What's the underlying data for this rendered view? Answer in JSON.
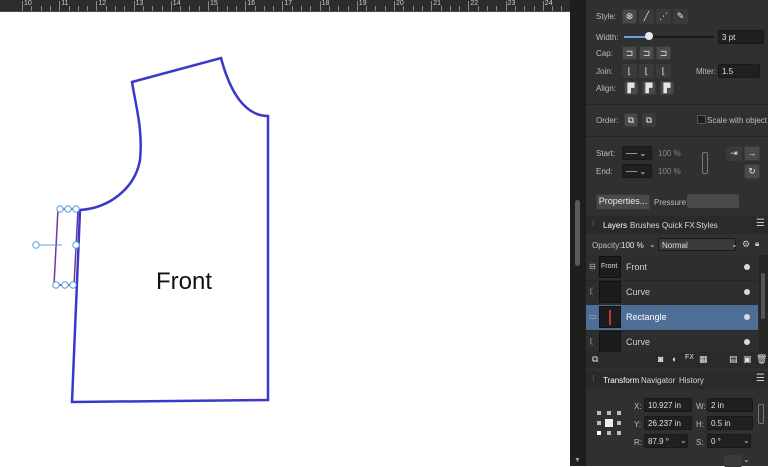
{
  "ruler": {
    "numbers": [
      "10",
      "11",
      "12",
      "13",
      "14",
      "15",
      "16",
      "17",
      "18",
      "19",
      "20",
      "21",
      "22",
      "23",
      "24"
    ]
  },
  "canvas": {
    "shape_label": "Front"
  },
  "stroke": {
    "style_label": "Style:",
    "width_label": "Width:",
    "width_value": "3 pt",
    "width_fraction": 0.28,
    "cap_label": "Cap:",
    "join_label": "Join:",
    "miter_label": "Miter:",
    "miter_value": "1.5",
    "align_label": "Align:",
    "order_label": "Order:",
    "scale_label": "Scale with object",
    "start_label": "Start:",
    "end_label": "End:",
    "start_pct": "100 %",
    "end_pct": "100 %",
    "properties_button": "Properties...",
    "pressure_label": "Pressure:"
  },
  "layers_panel": {
    "tabs": [
      "Layers",
      "Brushes",
      "Quick FX",
      "Styles"
    ],
    "opacity_label": "Opacity:",
    "opacity_value": "100 %",
    "blend_mode": "Normal",
    "thumb_text": "Front",
    "layers": [
      {
        "name": "Front",
        "selected": false
      },
      {
        "name": "Curve",
        "selected": false
      },
      {
        "name": "Rectangle",
        "selected": true
      },
      {
        "name": "Curve",
        "selected": false
      }
    ]
  },
  "transform_panel": {
    "tabs": [
      "Transform",
      "Navigator",
      "History"
    ],
    "x_label": "X:",
    "x_value": "10.927 in",
    "y_label": "Y:",
    "y_value": "26.237 in",
    "w_label": "W:",
    "w_value": "2 in",
    "h_label": "H:",
    "h_value": "0.5 in",
    "r_label": "R:",
    "r_value": "87.9 °",
    "s_label": "S:",
    "s_value": "0 °"
  },
  "colors": {
    "accent": "#3a3ac8",
    "selected_row": "#4f6e95",
    "panel_bg": "#303030"
  }
}
